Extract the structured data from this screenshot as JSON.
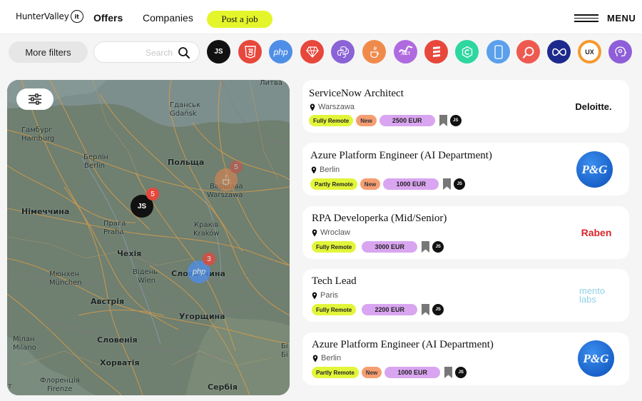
{
  "header": {
    "logo_text": "HunterValley",
    "logo_badge": "it",
    "nav": {
      "offers": "Offers",
      "companies": "Companies"
    },
    "post_job": "Post a job",
    "menu": "MENU"
  },
  "filters": {
    "more_filters": "More filters",
    "search_placeholder": "Search",
    "tech_icons": [
      {
        "name": "javascript",
        "label": "JS",
        "color": "#111111"
      },
      {
        "name": "html5",
        "label": "",
        "color": "#e8473c"
      },
      {
        "name": "php",
        "label": "php",
        "color": "#4f8ee6"
      },
      {
        "name": "ruby",
        "label": "",
        "color": "#e8473c"
      },
      {
        "name": "python",
        "label": "",
        "color": "#8a63d6"
      },
      {
        "name": "java",
        "label": "",
        "color": "#f08a4b"
      },
      {
        "name": "dotnet",
        "label": ".NET",
        "color": "#b06ae0"
      },
      {
        "name": "scala",
        "label": "",
        "color": "#e8473c"
      },
      {
        "name": "c-lang",
        "label": "",
        "color": "#2ed6a0"
      },
      {
        "name": "mobile",
        "label": "",
        "color": "#5aa0ec"
      },
      {
        "name": "testing",
        "label": "",
        "color": "#ee5a50"
      },
      {
        "name": "devops",
        "label": "",
        "color": "#1c2a8c"
      },
      {
        "name": "ux",
        "label": "UX",
        "color": "#f59a2e"
      },
      {
        "name": "head-ai",
        "label": "",
        "color": "#8e5fd8"
      }
    ]
  },
  "map": {
    "labels": [
      {
        "text": "Литва",
        "cls": ""
      },
      {
        "text": "Гданськ",
        "cls": ""
      },
      {
        "text": "Gdańsk",
        "cls": ""
      },
      {
        "text": "Гамбург",
        "cls": ""
      },
      {
        "text": "Hamburg",
        "cls": ""
      },
      {
        "text": "Берлін",
        "cls": ""
      },
      {
        "text": "Berlin",
        "cls": ""
      },
      {
        "text": "Польща",
        "cls": "big"
      },
      {
        "text": "Варшава",
        "cls": ""
      },
      {
        "text": "Warszawa",
        "cls": ""
      },
      {
        "text": "Німеччина",
        "cls": "big"
      },
      {
        "text": "Прага",
        "cls": ""
      },
      {
        "text": "Praha",
        "cls": ""
      },
      {
        "text": "Краків",
        "cls": ""
      },
      {
        "text": "Kraków",
        "cls": ""
      },
      {
        "text": "Чехія",
        "cls": "big"
      },
      {
        "text": "Мюнхен",
        "cls": ""
      },
      {
        "text": "München",
        "cls": ""
      },
      {
        "text": "Відень",
        "cls": ""
      },
      {
        "text": "Wien",
        "cls": ""
      },
      {
        "text": "Словаччина",
        "cls": "big"
      },
      {
        "text": "Австрія",
        "cls": "big"
      },
      {
        "text": "Угорщина",
        "cls": "big"
      },
      {
        "text": "Мілан",
        "cls": ""
      },
      {
        "text": "Milano",
        "cls": ""
      },
      {
        "text": "Словенія",
        "cls": "big"
      },
      {
        "text": "Хорватія",
        "cls": "big"
      },
      {
        "text": "Флоренція",
        "cls": ""
      },
      {
        "text": "Firenze",
        "cls": ""
      },
      {
        "text": "Сербія",
        "cls": "big"
      },
      {
        "text": "Іт",
        "cls": ""
      },
      {
        "text": "Бі",
        "cls": ""
      },
      {
        "text": "Бі",
        "cls": ""
      }
    ],
    "markers": [
      {
        "tech": "JS",
        "count": "5",
        "color": "#111111"
      },
      {
        "tech": "java",
        "count": "5",
        "color": "#f08a4b"
      },
      {
        "tech": "php",
        "count": "3",
        "color": "#4f8ee6"
      }
    ]
  },
  "jobs": [
    {
      "title": "ServiceNow Architect",
      "location": "Warszawa",
      "remote": "Fully Remote",
      "new": "New",
      "salary": "2500 EUR",
      "tech": "JS",
      "company": "Deloitte."
    },
    {
      "title": "Azure Platform Engineer (AI Department)",
      "location": "Berlin",
      "remote": "Partly Remote",
      "new": "New",
      "salary": "1000 EUR",
      "tech": "JS",
      "company": "P&G"
    },
    {
      "title": "RPA Developerka (Mid/Senior)",
      "location": "Wroclaw",
      "remote": "Fully Remote",
      "new": "",
      "salary": "3000 EUR",
      "tech": "JS",
      "company": "Raben"
    },
    {
      "title": "Tech Lead",
      "location": "Paris",
      "remote": "Fully Remote",
      "new": "",
      "salary": "2200 EUR",
      "tech": "JS",
      "company": "mento labs"
    },
    {
      "title": "Azure Platform Engineer (AI Department)",
      "location": "Berlin",
      "remote": "Partly Remote",
      "new": "New",
      "salary": "1000 EUR",
      "tech": "JS",
      "company": "P&G"
    }
  ],
  "colors": {
    "accent_yellow": "#e4f52b",
    "remote_tag": "#e2f53a",
    "new_tag": "#f59e72",
    "salary_tag": "#d9a5f0",
    "marker_badge": "#e5483d"
  }
}
